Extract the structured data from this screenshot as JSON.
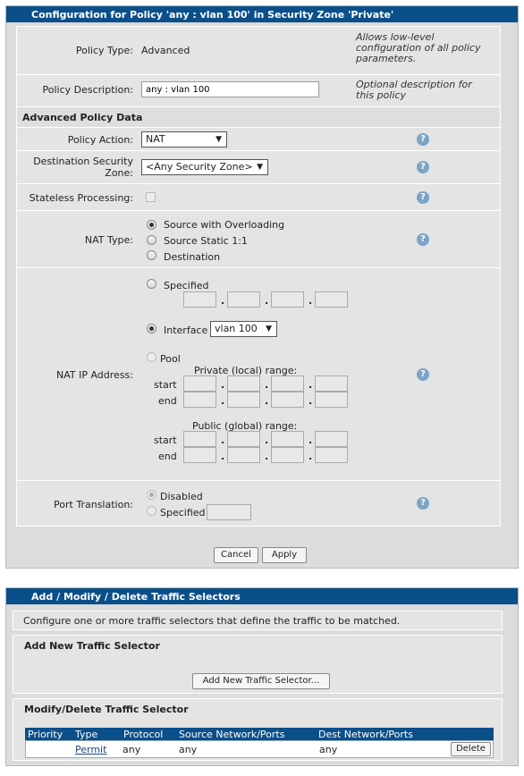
{
  "config": {
    "header": "Configuration for Policy 'any : vlan 100' in Security Zone 'Private'",
    "policy_type_label": "Policy Type:",
    "policy_type_value": "Advanced",
    "policy_type_note": "Allows low-level configuration of all policy parameters.",
    "policy_desc_label": "Policy Description:",
    "policy_desc_value": "any : vlan 100",
    "policy_desc_note": "Optional description for this policy",
    "advanced_title": "Advanced Policy Data",
    "policy_action_label": "Policy Action:",
    "policy_action_value": "NAT",
    "dest_zone_label": "Destination Security Zone:",
    "dest_zone_value": "<Any Security Zone>",
    "stateless_label": "Stateless Processing:",
    "nat_type_label": "NAT Type:",
    "nat_type_options": [
      "Source with Overloading",
      "Source Static 1:1",
      "Destination"
    ],
    "nat_type_selected": "Source with Overloading",
    "nat_ip_label": "NAT IP Address:",
    "specified_label": "Specified",
    "interface_label": "Interface",
    "interface_value": "vlan 100",
    "pool_label": "Pool",
    "private_range_label": "Private (local) range:",
    "public_range_label": "Public (global) range:",
    "start_label": "start",
    "end_label": "end",
    "port_translation_label": "Port Translation:",
    "port_disabled_label": "Disabled",
    "port_specified_label": "Specified",
    "help_glyph": "?",
    "cancel_label": "Cancel",
    "apply_label": "Apply"
  },
  "traffic": {
    "header": "Add / Modify / Delete Traffic Selectors",
    "intro": "Configure one or more traffic selectors that define the traffic to be matched.",
    "add_title": "Add New Traffic Selector",
    "add_button": "Add New Traffic Selector...",
    "modify_title": "Modify/Delete Traffic Selector",
    "columns": [
      "Priority",
      "Type",
      "Protocol",
      "Source Network/Ports",
      "Dest Network/Ports"
    ],
    "rows": [
      {
        "priority": "",
        "type": "Permit",
        "protocol": "any",
        "source": "any",
        "dest": "any",
        "action": "Delete"
      }
    ]
  },
  "colors": {
    "header_bg": "#0b4f8a",
    "panel_bg": "#dcdcdc",
    "help_icon": "#7aa4c8"
  }
}
